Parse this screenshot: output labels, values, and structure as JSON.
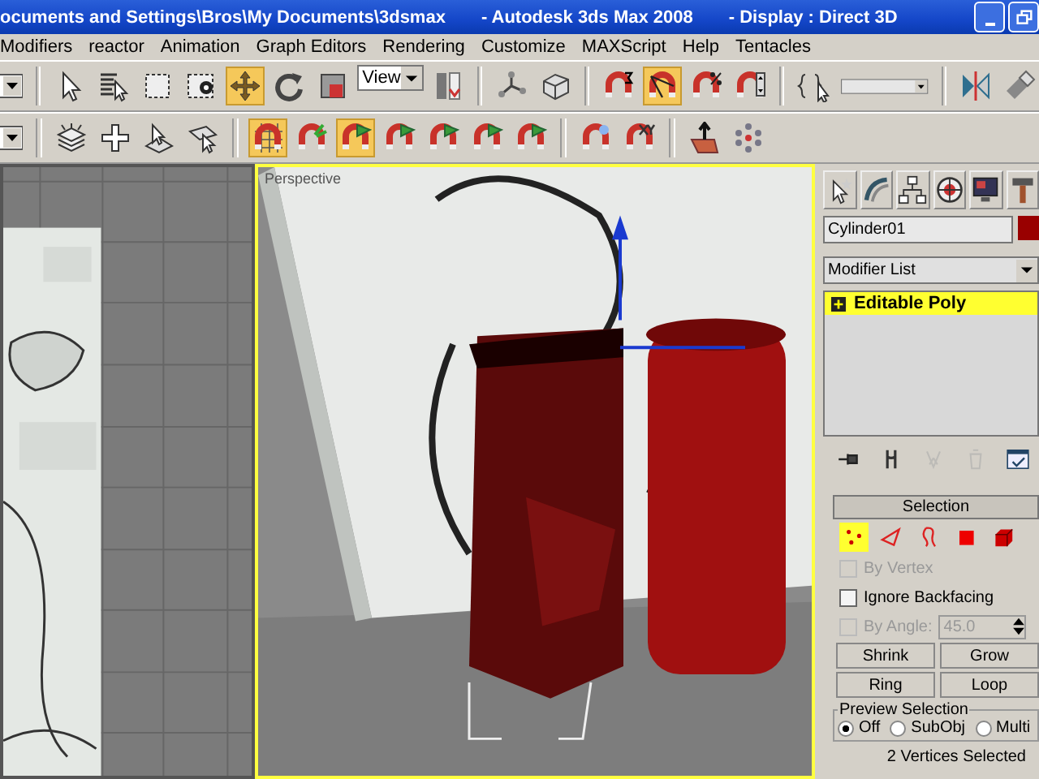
{
  "window": {
    "title_parts": [
      "ocuments and Settings\\Bros\\My Documents\\3dsmax",
      "- Autodesk 3ds Max 2008",
      "- Display : Direct 3D"
    ]
  },
  "menu": [
    "Modifiers",
    "reactor",
    "Animation",
    "Graph Editors",
    "Rendering",
    "Customize",
    "MAXScript",
    "Help",
    "Tentacles"
  ],
  "main_toolbar": [
    {
      "kind": "dropdown-cut",
      "selected": false
    },
    {
      "kind": "separator"
    },
    {
      "kind": "select",
      "selected": false
    },
    {
      "kind": "select-by-name",
      "selected": false
    },
    {
      "kind": "rect-region",
      "selected": false
    },
    {
      "kind": "window-crossing",
      "selected": false
    },
    {
      "kind": "move",
      "selected": true
    },
    {
      "kind": "rotate",
      "selected": false
    },
    {
      "kind": "scale",
      "selected": false
    },
    {
      "kind": "coord-dropdown",
      "value": "View"
    },
    {
      "kind": "pivot",
      "selected": false
    },
    {
      "kind": "separator"
    },
    {
      "kind": "manipulate",
      "selected": false
    },
    {
      "kind": "box",
      "selected": false
    },
    {
      "kind": "separator"
    },
    {
      "kind": "snap3",
      "selected": false
    },
    {
      "kind": "angle-snap",
      "selected": true
    },
    {
      "kind": "percent-snap",
      "selected": false
    },
    {
      "kind": "spinner-snap",
      "selected": false
    },
    {
      "kind": "separator"
    },
    {
      "kind": "named-sets",
      "selected": false
    },
    {
      "kind": "sets-field"
    },
    {
      "kind": "separator"
    },
    {
      "kind": "mirror",
      "selected": false
    },
    {
      "kind": "align",
      "selected": false
    }
  ],
  "snap_toolbar": [
    {
      "kind": "dropdown-cut",
      "selected": false
    },
    {
      "kind": "separator"
    },
    {
      "kind": "layers",
      "selected": false
    },
    {
      "kind": "plus",
      "selected": false
    },
    {
      "kind": "select-plane",
      "selected": false
    },
    {
      "kind": "select-hand",
      "selected": false
    },
    {
      "kind": "separator"
    },
    {
      "kind": "grid-magnet",
      "selected": true
    },
    {
      "kind": "magnet-sprout",
      "selected": false
    },
    {
      "kind": "magnet-flag",
      "selected": true
    },
    {
      "kind": "magnet-flag",
      "selected": false
    },
    {
      "kind": "magnet-flag",
      "selected": false
    },
    {
      "kind": "magnet-flag",
      "selected": false
    },
    {
      "kind": "magnet-flag",
      "selected": false
    },
    {
      "kind": "separator"
    },
    {
      "kind": "magnet-star",
      "selected": false
    },
    {
      "kind": "magnet-xy",
      "selected": false
    },
    {
      "kind": "separator"
    },
    {
      "kind": "grid-arrow",
      "selected": false
    },
    {
      "kind": "dots",
      "selected": false
    }
  ],
  "viewports": [
    {
      "kind": "sketch-grid",
      "active": false
    },
    {
      "kind": "perspective",
      "label": "Perspective",
      "active": true
    }
  ],
  "command_panel": {
    "tabs": [
      {
        "kind": "create"
      },
      {
        "kind": "modify"
      },
      {
        "kind": "hierarchy"
      },
      {
        "kind": "motion"
      },
      {
        "kind": "display"
      },
      {
        "kind": "utilities"
      }
    ],
    "object_name": "Cylinder01",
    "modifier_list": "Modifier List",
    "stack": [
      {
        "label": "Editable Poly",
        "selected": true
      }
    ],
    "stack_tools": [
      {
        "kind": "pin",
        "disabled": false
      },
      {
        "kind": "fork",
        "disabled": false
      },
      {
        "kind": "unique",
        "disabled": true
      },
      {
        "kind": "remove",
        "disabled": true
      },
      {
        "kind": "configure",
        "disabled": false
      }
    ],
    "selection": {
      "title": "Selection",
      "subobjects": [
        {
          "kind": "vertex",
          "selected": true
        },
        {
          "kind": "edge",
          "selected": false
        },
        {
          "kind": "border",
          "selected": false
        },
        {
          "kind": "polygon",
          "selected": false
        },
        {
          "kind": "element",
          "selected": false
        }
      ],
      "by_vertex": {
        "label": "By Vertex",
        "checked": false,
        "disabled": true
      },
      "ignore_backfacing": {
        "label": "Ignore Backfacing",
        "checked": false,
        "disabled": false
      },
      "by_angle": {
        "label": "By Angle:",
        "checked": false,
        "disabled": true,
        "value": "45.0"
      },
      "buttons": [
        [
          "Shrink",
          "Grow"
        ],
        [
          "Ring",
          "Loop"
        ]
      ],
      "preview": {
        "title": "Preview Selection",
        "options": [
          {
            "label": "Off",
            "selected": true
          },
          {
            "label": "SubObj",
            "selected": false
          },
          {
            "label": "Multi",
            "selected": false
          }
        ]
      },
      "status": "2 Vertices Selected"
    }
  }
}
